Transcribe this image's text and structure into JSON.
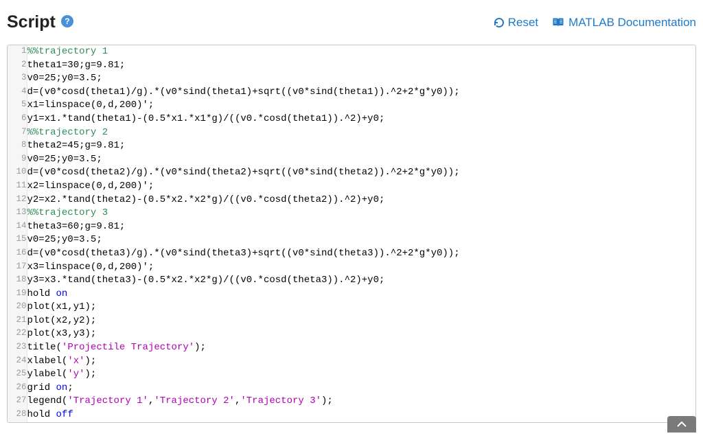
{
  "header": {
    "title": "Script",
    "reset_label": "Reset",
    "docs_label": "MATLAB Documentation"
  },
  "code_lines": [
    {
      "num": "1",
      "segments": [
        {
          "text": "%%trajectory 1",
          "cls": "comment"
        }
      ]
    },
    {
      "num": "2",
      "segments": [
        {
          "text": "theta1=30;g=9.81;"
        }
      ]
    },
    {
      "num": "3",
      "segments": [
        {
          "text": "v0=25;y0=3.5;"
        }
      ]
    },
    {
      "num": "4",
      "segments": [
        {
          "text": "d=(v0*cosd(theta1)/g).*(v0*sind(theta1)+sqrt((v0*sind(theta1)).^2+2*g*y0));"
        }
      ]
    },
    {
      "num": "5",
      "segments": [
        {
          "text": "x1=linspace(0,d,200)';"
        }
      ]
    },
    {
      "num": "6",
      "segments": [
        {
          "text": "y1=x1.*tand(theta1)-(0.5*x1.*x1*g)/((v0.*cosd(theta1)).^2)+y0;"
        }
      ]
    },
    {
      "num": "7",
      "segments": [
        {
          "text": "%%trajectory 2",
          "cls": "comment"
        }
      ]
    },
    {
      "num": "8",
      "segments": [
        {
          "text": "theta2=45;g=9.81;"
        }
      ]
    },
    {
      "num": "9",
      "segments": [
        {
          "text": "v0=25;y0=3.5;"
        }
      ]
    },
    {
      "num": "10",
      "segments": [
        {
          "text": "d=(v0*cosd(theta2)/g).*(v0*sind(theta2)+sqrt((v0*sind(theta2)).^2+2*g*y0));"
        }
      ]
    },
    {
      "num": "11",
      "segments": [
        {
          "text": "x2=linspace(0,d,200)';"
        }
      ]
    },
    {
      "num": "12",
      "segments": [
        {
          "text": "y2=x2.*tand(theta2)-(0.5*x2.*x2*g)/((v0.*cosd(theta2)).^2)+y0;"
        }
      ]
    },
    {
      "num": "13",
      "segments": [
        {
          "text": "%%trajectory 3",
          "cls": "comment"
        }
      ]
    },
    {
      "num": "14",
      "segments": [
        {
          "text": "theta3=60;g=9.81;"
        }
      ]
    },
    {
      "num": "15",
      "segments": [
        {
          "text": "v0=25;y0=3.5;"
        }
      ]
    },
    {
      "num": "16",
      "segments": [
        {
          "text": "d=(v0*cosd(theta3)/g).*(v0*sind(theta3)+sqrt((v0*sind(theta3)).^2+2*g*y0));"
        }
      ]
    },
    {
      "num": "17",
      "segments": [
        {
          "text": "x3=linspace(0,d,200)';"
        }
      ]
    },
    {
      "num": "18",
      "segments": [
        {
          "text": "y3=x3.*tand(theta3)-(0.5*x2.*x2*g)/((v0.*cosd(theta3)).^2)+y0;"
        }
      ]
    },
    {
      "num": "19",
      "segments": [
        {
          "text": "hold "
        },
        {
          "text": "on",
          "cls": "keyword"
        }
      ]
    },
    {
      "num": "20",
      "segments": [
        {
          "text": "plot(x1,y1);"
        }
      ]
    },
    {
      "num": "21",
      "segments": [
        {
          "text": "plot(x2,y2);"
        }
      ]
    },
    {
      "num": "22",
      "segments": [
        {
          "text": "plot(x3,y3);"
        }
      ]
    },
    {
      "num": "23",
      "segments": [
        {
          "text": "title("
        },
        {
          "text": "'Projectile Trajectory'",
          "cls": "string"
        },
        {
          "text": ");"
        }
      ]
    },
    {
      "num": "24",
      "segments": [
        {
          "text": "xlabel("
        },
        {
          "text": "'x'",
          "cls": "string"
        },
        {
          "text": ");"
        }
      ]
    },
    {
      "num": "25",
      "segments": [
        {
          "text": "ylabel("
        },
        {
          "text": "'y'",
          "cls": "string"
        },
        {
          "text": ");"
        }
      ]
    },
    {
      "num": "26",
      "segments": [
        {
          "text": "grid "
        },
        {
          "text": "on",
          "cls": "keyword"
        },
        {
          "text": ";"
        }
      ]
    },
    {
      "num": "27",
      "segments": [
        {
          "text": "legend("
        },
        {
          "text": "'Trajectory 1'",
          "cls": "string"
        },
        {
          "text": ","
        },
        {
          "text": "'Trajectory 2'",
          "cls": "string"
        },
        {
          "text": ","
        },
        {
          "text": "'Trajectory 3'",
          "cls": "string"
        },
        {
          "text": ");"
        }
      ]
    },
    {
      "num": "28",
      "segments": [
        {
          "text": "hold "
        },
        {
          "text": "off",
          "cls": "keyword"
        }
      ]
    }
  ]
}
